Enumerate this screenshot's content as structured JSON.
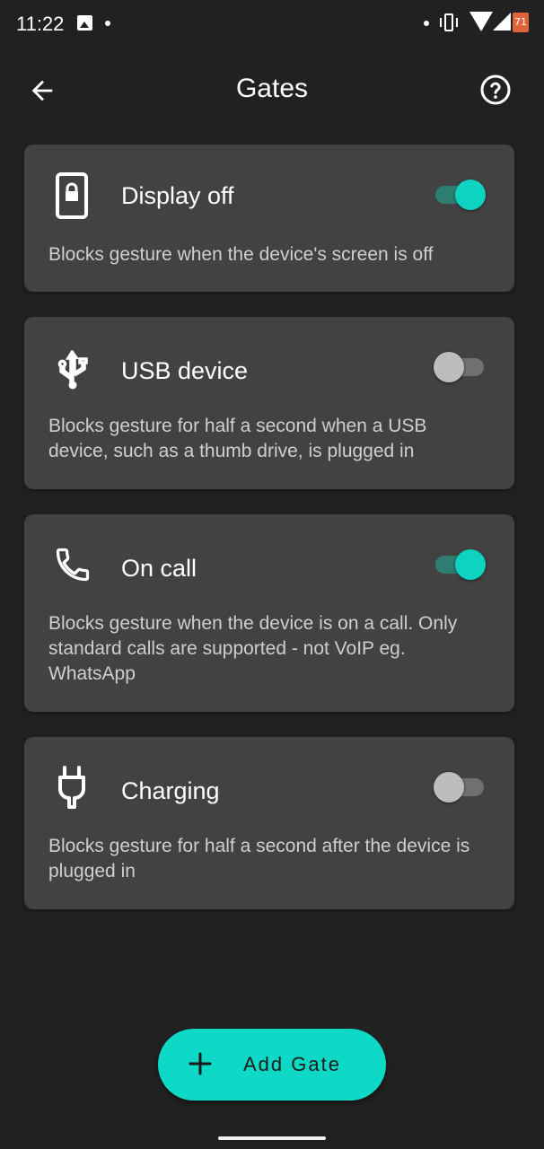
{
  "status_bar": {
    "time": "11:22",
    "battery_level": "71"
  },
  "app_bar": {
    "title": "Gates",
    "back_icon": "arrow-back-icon",
    "help_icon": "help-circle-icon"
  },
  "gates": [
    {
      "label": "Display off",
      "description": "Blocks gesture when the device's screen is off",
      "icon": "phone-lock-icon",
      "enabled": true
    },
    {
      "label": "USB device",
      "description": "Blocks gesture for half a second when a USB device, such as a thumb drive, is plugged in",
      "icon": "usb-icon",
      "enabled": false
    },
    {
      "label": "On call",
      "description": "Blocks gesture when the device is on a call. Only standard calls are supported - not VoIP eg. WhatsApp",
      "icon": "phone-icon",
      "enabled": true
    },
    {
      "label": "Charging",
      "description": "Blocks gesture for half a second after the device is plugged in",
      "icon": "power-plug-icon",
      "enabled": false
    }
  ],
  "fab": {
    "label": "Add Gate",
    "icon": "plus-icon"
  },
  "colors": {
    "background": "#212121",
    "card": "#424242",
    "accent": "#0dd9c6",
    "toggle_on_track": "#2e7d71"
  }
}
